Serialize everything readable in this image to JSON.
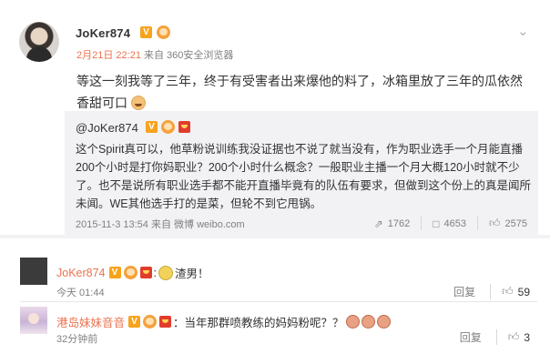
{
  "post": {
    "author": "JoKer874",
    "verified_badge": "V",
    "date": "2月21日 22:21",
    "source": "来自 360安全浏览器",
    "text": "等这一刻我等了三年，终于有受害者出来爆他的料了，冰箱里放了三年的瓜依然香甜可口",
    "icons": {
      "menu": "chevron-down-icon",
      "emoji": "smile-emoji-icon"
    }
  },
  "repost": {
    "author": "@JoKer874",
    "text": "这个Spirit真可以，他草粉说训练我没证据也不说了就当没有，作为职业选手一个月能直播200个小时是打你妈职业？200个小时什么概念？一般职业主播一个月大概120小时就不少了。也不是说所有职业选手都不能开直播毕竟有的队伍有要求，但做到这个份上的真是闻所未闻。WE其他选手打的是菜，但轮不到它甩锅。",
    "meta": "2015-11-3 13:54 来自 微博 weibo.com",
    "stats": {
      "reposts": "1762",
      "comments": "4653",
      "likes": "2575"
    },
    "icons": {
      "repost": "share-icon",
      "comment": "comment-icon",
      "like": "thumbs-up-icon"
    }
  },
  "comments": [
    {
      "name": "JoKer874",
      "separator": ":",
      "text": "渣男！",
      "time": "今天 01:44",
      "reply_label": "回复",
      "likes": "59"
    },
    {
      "name": "港岛妹妹音音",
      "separator": "：",
      "text": "当年那群喷教练的妈妈粉呢？？",
      "time": "32分钟前",
      "reply_label": "回复",
      "likes": "3"
    }
  ],
  "colors": {
    "name_link": "#eb7350",
    "date_link": "#eb7350",
    "repost_bg": "#f2f2f5",
    "vip_badge": "#f7a31c"
  }
}
